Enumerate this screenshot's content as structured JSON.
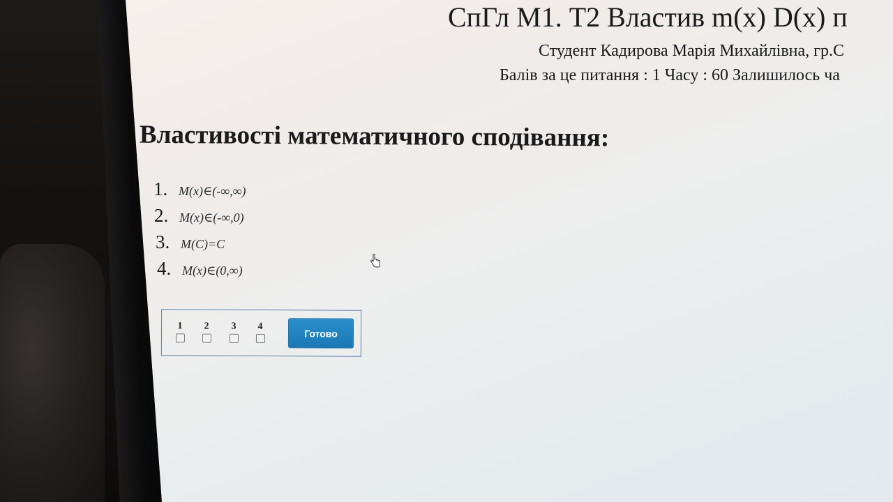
{
  "header": {
    "test_title": "СпГл М1. Т2 Властив m(x) D(x) п",
    "student_line": "Студент Кадирова Марія Михайлівна, гр.С",
    "score_line": "Балів за це питання : 1 Часу : 60 Залишилось ча"
  },
  "question": {
    "heading": "Властивості математичного сподівання:",
    "options": [
      {
        "number": "1.",
        "formula": "M(x)∈(-∞,∞)"
      },
      {
        "number": "2.",
        "formula": "M(x)∈(-∞,0)"
      },
      {
        "number": "3.",
        "formula": "M(C)=C"
      },
      {
        "number": "4.",
        "formula": "M(x)∈(0,∞)"
      }
    ]
  },
  "answer_panel": {
    "choices": [
      "1",
      "2",
      "3",
      "4"
    ],
    "done_label": "Готово",
    "button_color": "#1e82bf",
    "border_color": "#5f7fae"
  },
  "icons": {
    "cursor": "hand-pointer-icon",
    "checkbox": "checkbox-icon"
  }
}
